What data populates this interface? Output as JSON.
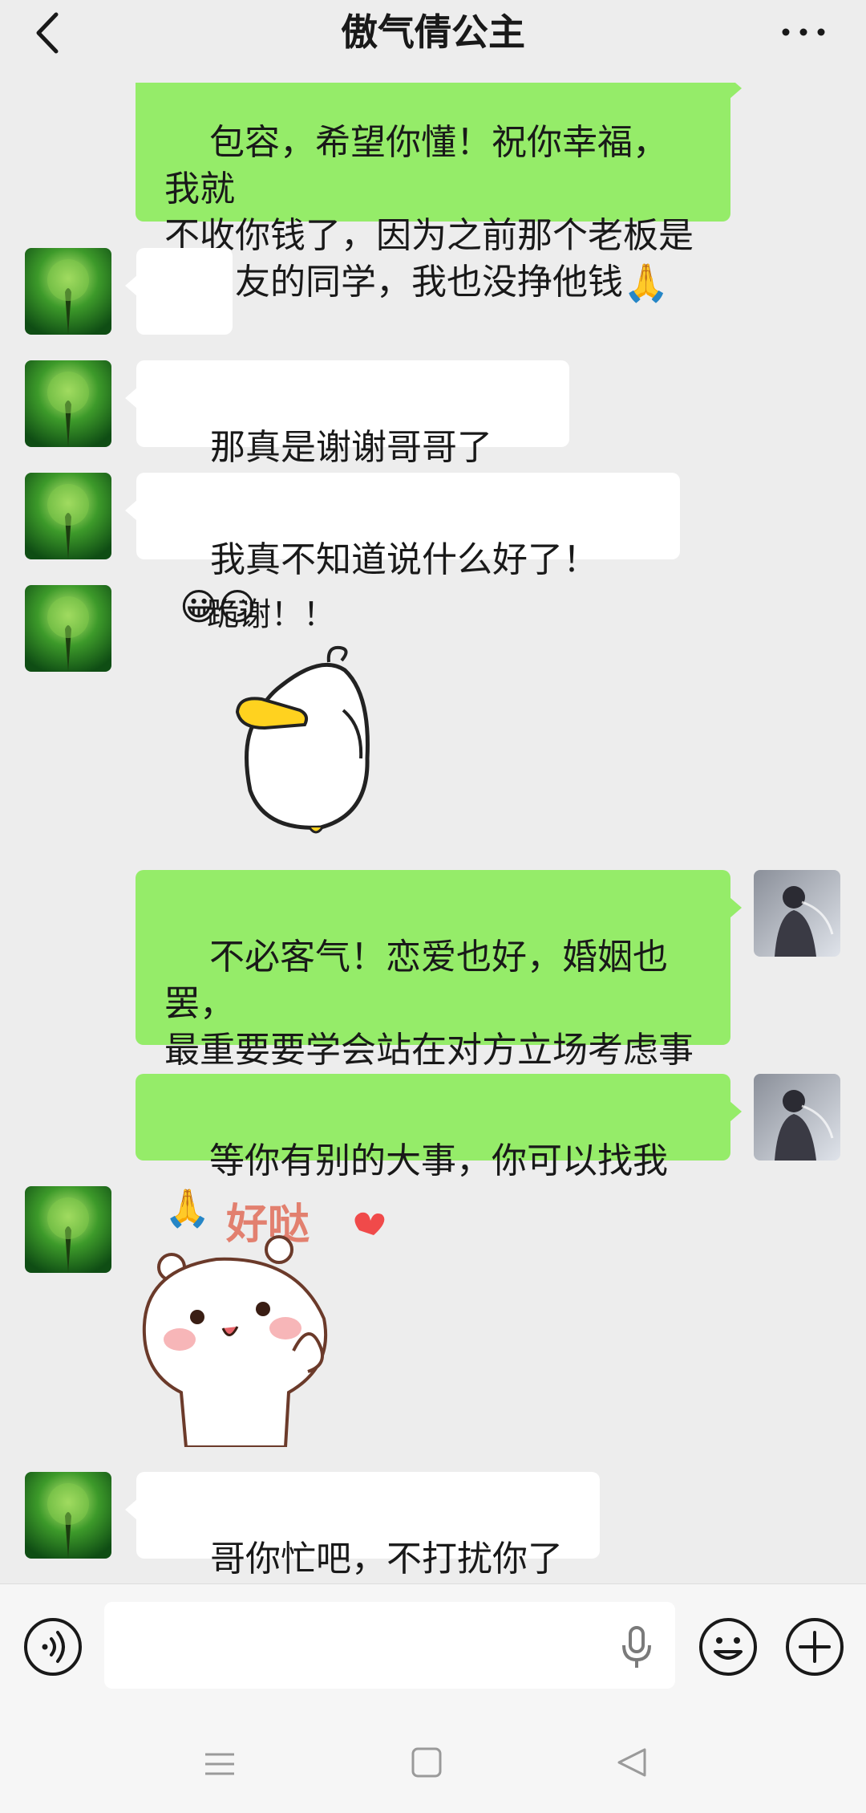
{
  "header": {
    "title": "傲气倩公主",
    "back_icon": "chevron-left-icon",
    "more_icon": "more-dots-icon"
  },
  "colors": {
    "background": "#ededed",
    "outgoing_bubble": "#95ec69",
    "incoming_bubble": "#ffffff"
  },
  "messages": [
    {
      "side": "out",
      "text": "包容，希望你懂！祝你幸福，我就\n不收你钱了，因为之前那个老板是\n我朋友的同学，我也没挣他钱",
      "emoji": "🙏"
    },
    {
      "side": "in",
      "text": "",
      "emoji": "😍"
    },
    {
      "side": "in",
      "text": "那真是谢谢哥哥了",
      "emoji": "🤭🤭"
    },
    {
      "side": "in",
      "text": "我真不知道说什么好了！",
      "emoji": "😀😏"
    },
    {
      "side": "in",
      "sticker": "duck-sticker",
      "sticker_text": "跪谢！！"
    },
    {
      "side": "out",
      "text": "不必客气！恋爱也好，婚姻也罢，\n最重要要学会站在对方立场考虑事\n情",
      "emoji": ""
    },
    {
      "side": "out",
      "text": "等你有别的大事，你可以找我",
      "emoji": "🙏"
    },
    {
      "side": "in",
      "sticker": "bear-sticker",
      "sticker_text": "好哒"
    },
    {
      "side": "in",
      "text": "哥你忙吧，不打扰你了",
      "emoji": "🫡"
    }
  ],
  "input_bar": {
    "voice_icon": "voice-icon",
    "mic_icon": "microphone-icon",
    "emoji_icon": "smiley-face-icon",
    "plus_icon": "plus-circle-icon",
    "placeholder": ""
  },
  "nav_bar": {
    "icons": [
      "menu-icon",
      "home-square-icon",
      "back-triangle-icon"
    ]
  }
}
